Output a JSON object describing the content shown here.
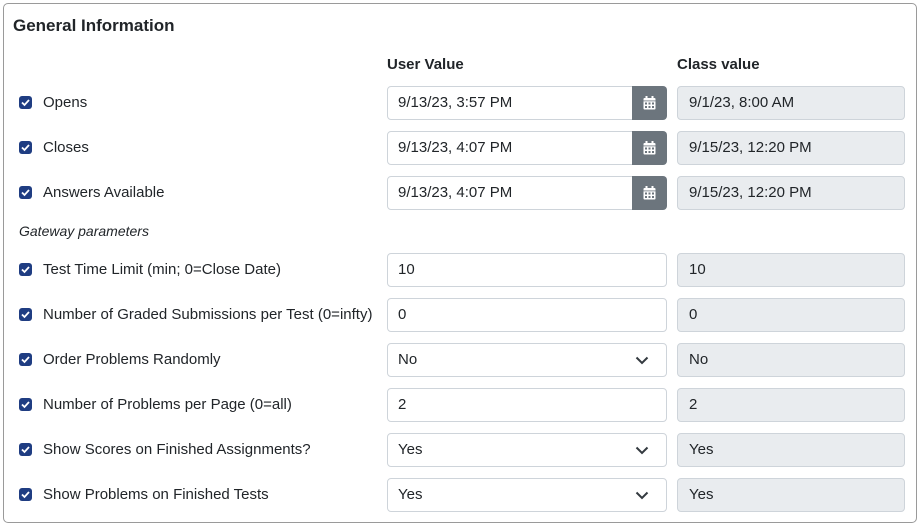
{
  "title": "General Information",
  "headers": {
    "user": "User Value",
    "class": "Class value"
  },
  "section_label": "Gateway parameters",
  "rows": [
    {
      "label": "Opens",
      "user_value": "9/13/23, 3:57 PM",
      "class_value": "9/1/23, 8:00 AM",
      "checked": true,
      "type": "date"
    },
    {
      "label": "Closes",
      "user_value": "9/13/23, 4:07 PM",
      "class_value": "9/15/23, 12:20 PM",
      "checked": true,
      "type": "date"
    },
    {
      "label": "Answers Available",
      "user_value": "9/13/23, 4:07 PM",
      "class_value": "9/15/23, 12:20 PM",
      "checked": true,
      "type": "date"
    },
    {
      "label": "Test Time Limit (min; 0=Close Date)",
      "user_value": "10",
      "class_value": "10",
      "checked": true,
      "type": "text"
    },
    {
      "label": "Number of Graded Submissions per Test (0=infty)",
      "user_value": "0",
      "class_value": "0",
      "checked": true,
      "type": "text"
    },
    {
      "label": "Order Problems Randomly",
      "user_value": "No",
      "class_value": "No",
      "checked": true,
      "type": "select"
    },
    {
      "label": "Number of Problems per Page (0=all)",
      "user_value": "2",
      "class_value": "2",
      "checked": true,
      "type": "text"
    },
    {
      "label": "Show Scores on Finished Assignments?",
      "user_value": "Yes",
      "class_value": "Yes",
      "checked": true,
      "type": "select"
    },
    {
      "label": "Show Problems on Finished Tests",
      "user_value": "Yes",
      "class_value": "Yes",
      "checked": true,
      "type": "select"
    }
  ],
  "icons": {
    "checkbox": "checkmark-icon",
    "calendar": "calendar-icon",
    "dropdown": "chevron-down-icon"
  },
  "colors": {
    "checkbox": "#1f3d82",
    "calendar_button": "#6c757d",
    "readonly_bg": "#e9ecef"
  }
}
